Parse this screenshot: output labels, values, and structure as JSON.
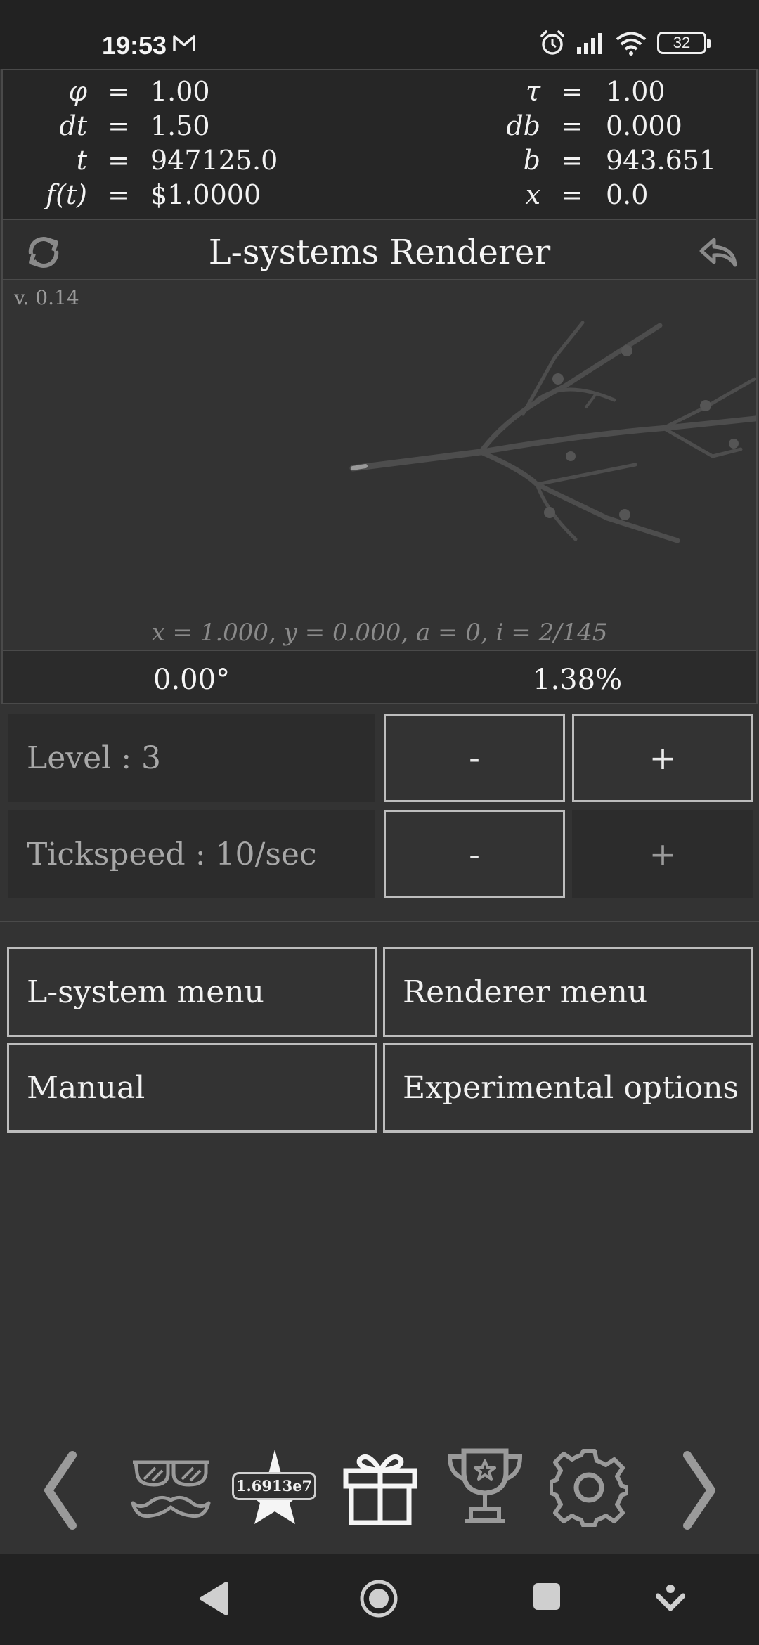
{
  "status": {
    "time": "19:53",
    "battery": "32",
    "icons": [
      "gmail-icon",
      "alarm-icon",
      "signal-icon",
      "wifi-icon",
      "battery-icon"
    ]
  },
  "equations": {
    "phi_sym": "φ",
    "phi_val": "1.00",
    "dt_sym": "dt",
    "dt_val": "1.50",
    "t_sym": "t",
    "t_val": "947125.0",
    "ft_sym": "f(t)",
    "ft_val": "$1.0000",
    "tau_sym": "τ",
    "tau_val": "1.00",
    "db_sym": "db",
    "db_val": "0.000",
    "b_sym": "b",
    "b_val": "943.651",
    "x_sym": "x",
    "x_val": "0.0",
    "eq": "="
  },
  "header": {
    "title": "L-systems Renderer",
    "left_icon": "refresh-icon",
    "right_icon": "undo-icon"
  },
  "canvas": {
    "version": "v. 0.14",
    "coords": "x = 1.000,   y = 0.000,   a = 0,   i = 2/145"
  },
  "stats": {
    "angle": "0.00°",
    "progress": "1.38%"
  },
  "controls": {
    "level_label": "Level :  3",
    "tickspeed_label": "Tickspeed :  10/sec",
    "minus": "-",
    "plus": "+"
  },
  "menus": {
    "lsystem": "L-system menu",
    "renderer": "Renderer menu",
    "manual": "Manual",
    "experimental": "Experimental options"
  },
  "toolbar": {
    "star_value": "1.6913e7",
    "icons": [
      "chevron-left-icon",
      "disguise-icon",
      "star-icon",
      "gift-icon",
      "trophy-icon",
      "gear-icon",
      "chevron-right-icon"
    ]
  },
  "navigation": {
    "icons": [
      "back-icon",
      "home-icon",
      "recents-icon",
      "assistant-icon"
    ]
  }
}
